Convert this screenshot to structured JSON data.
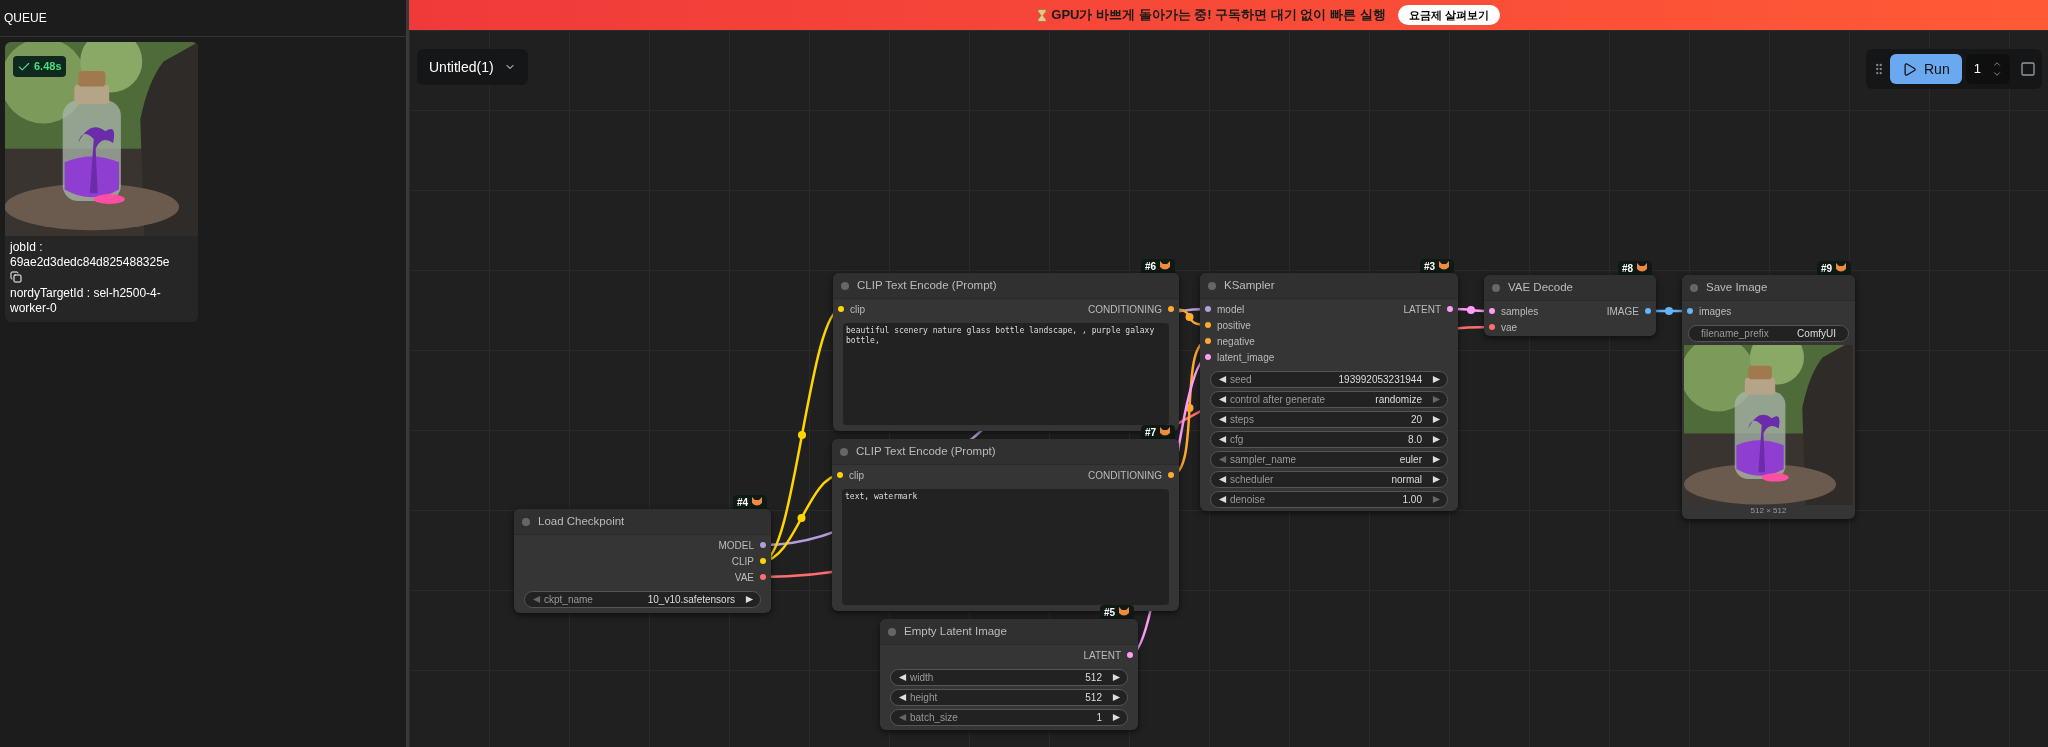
{
  "queue": {
    "title": "QUEUE",
    "jobs": [
      {
        "done": true,
        "duration": "6.48s",
        "job_id": "jobId : 69ae2d3dedc84d825488325e",
        "target": "nordyTargetId : sel-h2500-4-worker-0"
      }
    ]
  },
  "banner": {
    "message": "GPU가 바쁘게 돌아가는 중! 구독하면 대기 없이 빠른 실행",
    "button": "요금제 살펴보기"
  },
  "workflow_tab": {
    "title": "Untitled(1)"
  },
  "run_toolbar": {
    "button": "Run",
    "count": "1"
  },
  "nodes": [
    {
      "id": "#6",
      "title": "CLIP Text Encode (Prompt)",
      "inputs": [
        {
          "label": "clip",
          "color": "#ffd500"
        }
      ],
      "outputs": [
        {
          "label": "CONDITIONING",
          "color": "#ffa931"
        }
      ],
      "widgets": [
        {
          "kind": "text",
          "value": "beautiful scenery nature glass bottle landscape, , purple galaxy bottle,"
        }
      ]
    },
    {
      "id": "#3",
      "title": "KSampler",
      "inputs": [
        {
          "label": "model",
          "color": "#b39ddb"
        },
        {
          "label": "positive",
          "color": "#ffa931"
        },
        {
          "label": "negative",
          "color": "#ffa931"
        },
        {
          "label": "latent_image",
          "color": "#ff9cf9"
        }
      ],
      "outputs": [
        {
          "label": "LATENT",
          "color": "#ff9cf9"
        }
      ],
      "widgets": [
        {
          "kind": "stepper",
          "name": "seed",
          "value": "193992053231944",
          "prev_enabled": true,
          "next_enabled": true
        },
        {
          "kind": "stepper",
          "name": "control after generate",
          "value": "randomize",
          "prev_enabled": true,
          "next_enabled": false
        },
        {
          "kind": "stepper",
          "name": "steps",
          "value": "20",
          "prev_enabled": true,
          "next_enabled": true
        },
        {
          "kind": "stepper",
          "name": "cfg",
          "value": "8.0",
          "prev_enabled": true,
          "next_enabled": true
        },
        {
          "kind": "stepper",
          "name": "sampler_name",
          "value": "euler",
          "prev_enabled": false,
          "next_enabled": true
        },
        {
          "kind": "stepper",
          "name": "scheduler",
          "value": "normal",
          "prev_enabled": true,
          "next_enabled": true
        },
        {
          "kind": "stepper",
          "name": "denoise",
          "value": "1.00",
          "prev_enabled": true,
          "next_enabled": false
        }
      ]
    },
    {
      "id": "#8",
      "title": "VAE Decode",
      "inputs": [
        {
          "label": "samples",
          "color": "#ff9cf9"
        },
        {
          "label": "vae",
          "color": "#ff6e6e"
        }
      ],
      "outputs": [
        {
          "label": "IMAGE",
          "color": "#64b5f6"
        }
      ]
    },
    {
      "id": "#9",
      "title": "Save Image",
      "inputs": [
        {
          "label": "images",
          "color": "#64b5f6"
        }
      ],
      "widgets": [
        {
          "kind": "field",
          "name": "filename_prefix",
          "value": "ComfyUI"
        }
      ],
      "preview": {
        "kind": "picture",
        "caption": "512 × 512"
      }
    },
    {
      "id": "#7",
      "title": "CLIP Text Encode (Prompt)",
      "inputs": [
        {
          "label": "clip",
          "color": "#ffd500"
        }
      ],
      "outputs": [
        {
          "label": "CONDITIONING",
          "color": "#ffa931"
        }
      ],
      "widgets": [
        {
          "kind": "text",
          "value": "text, watermark"
        }
      ]
    },
    {
      "id": "#4",
      "title": "Load Checkpoint",
      "outputs": [
        {
          "label": "MODEL",
          "color": "#b39ddb"
        },
        {
          "label": "CLIP",
          "color": "#ffd500"
        },
        {
          "label": "VAE",
          "color": "#ff6e6e"
        }
      ],
      "widgets": [
        {
          "kind": "stepper",
          "name": "ckpt_name",
          "value": "10_v10.safetensors",
          "prev_enabled": false,
          "next_enabled": true
        }
      ]
    },
    {
      "id": "#5",
      "title": "Empty Latent Image",
      "outputs": [
        {
          "label": "LATENT",
          "color": "#ff9cf9"
        }
      ],
      "widgets": [
        {
          "kind": "stepper",
          "name": "width",
          "value": "512",
          "prev_enabled": true,
          "next_enabled": true
        },
        {
          "kind": "stepper",
          "name": "height",
          "value": "512",
          "prev_enabled": true,
          "next_enabled": true
        },
        {
          "kind": "stepper",
          "name": "batch_size",
          "value": "1",
          "prev_enabled": false,
          "next_enabled": true
        }
      ]
    }
  ]
}
